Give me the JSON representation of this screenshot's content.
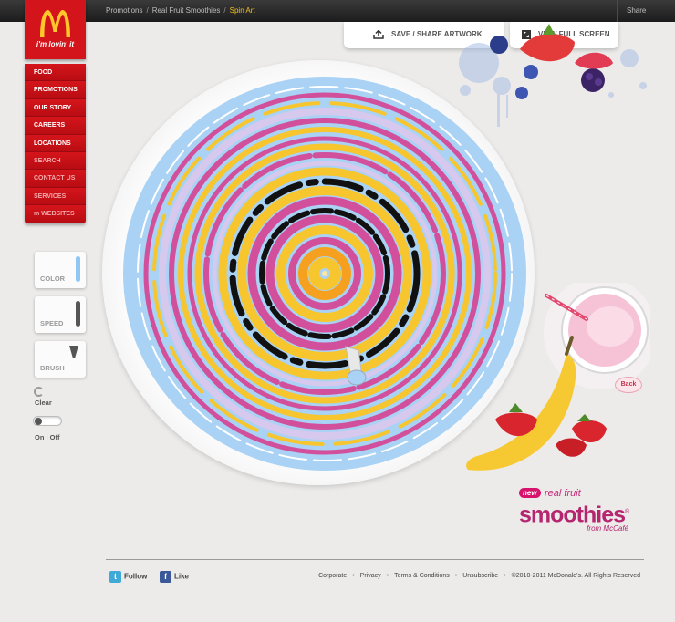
{
  "breadcrumbs": [
    "Promotions",
    "Real Fruit Smoothies",
    "Spin Art"
  ],
  "share_label": "Share",
  "logo": {
    "tagline": "i'm lovin' it",
    "colors": {
      "red": "#d4141b",
      "gold": "#ffc72c"
    }
  },
  "nav": {
    "items": [
      {
        "label": "FOOD"
      },
      {
        "label": "PROMOTIONS"
      },
      {
        "label": "OUR STORY"
      },
      {
        "label": "CAREERS"
      },
      {
        "label": "LOCATIONS"
      },
      {
        "label": "SEARCH"
      },
      {
        "label": "CONTACT US"
      },
      {
        "label": "SERVICES"
      },
      {
        "label": "WEBSITES"
      }
    ]
  },
  "toolbar": {
    "save_label": "SAVE / SHARE ARTWORK",
    "fullscreen_label": "VIEW FULL SCREEN"
  },
  "tools": {
    "color_label": "COLOR",
    "color_value": "#8fc6f3",
    "speed_label": "SPEED",
    "brush_label": "BRUSH",
    "clear_label": "Clear",
    "onoff_label": "On | Off"
  },
  "promo": {
    "back_label": "Back",
    "new_label": "new",
    "line1": "real fruit",
    "line2": "smoothies",
    "line3": "from McCafé",
    "mark": "®"
  },
  "footer": {
    "follow_label": "Follow",
    "like_label": "Like",
    "links": [
      "Corporate",
      "Privacy",
      "Terms & Conditions",
      "Unsubscribe",
      "©2010-2011  McDonald's. All Rights Reserved"
    ]
  },
  "art_colors": {
    "blue": "#a9d2f4",
    "pink": "#d24f9c",
    "yellow": "#f7c62f",
    "lavender": "#d7c8ee",
    "black": "#111111",
    "orange": "#f6a01f"
  }
}
